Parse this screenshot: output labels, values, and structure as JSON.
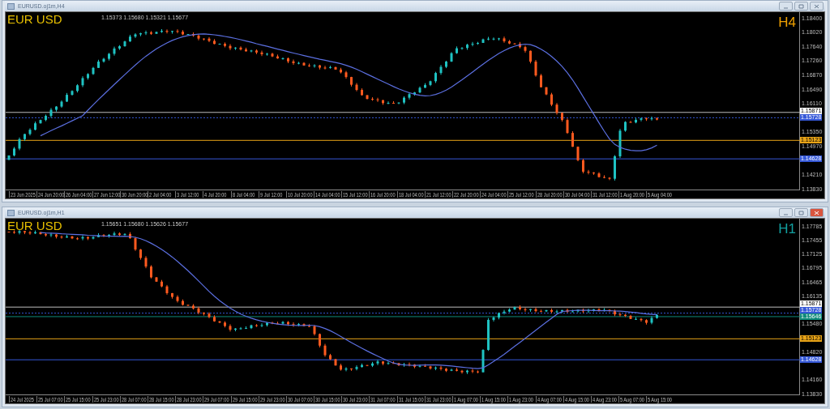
{
  "windows": [
    {
      "title": "EURUSD.oj1m,H4",
      "symbol": "EUR USD",
      "info": "1.15373 1.15680 1.15321 1.15677",
      "timeframe": "H4",
      "color": "#f0a000",
      "active": false,
      "price_axis": [
        "1.18400",
        "1.18020",
        "1.17640",
        "1.17260",
        "1.16870",
        "1.16490",
        "1.16110",
        "1.15350",
        "1.14970",
        "1.14210",
        "1.13830"
      ],
      "price_lines": [
        {
          "label": "1.15871",
          "color": "#ffffff",
          "kind": "solid"
        },
        {
          "label": "1.15728",
          "color": "#3558d8",
          "kind": "dotted"
        },
        {
          "label": "1.15123",
          "color": "#e8a317",
          "kind": "solid"
        },
        {
          "label": "1.14628",
          "color": "#3558d8",
          "kind": "solid"
        }
      ],
      "time_axis": [
        "23 Jun 2025",
        "24 Jun 20:00",
        "26 Jun 04:00",
        "27 Jun 12:00",
        "30 Jun 20:00",
        "2 Jul 04:00",
        "3 Jul 12:00",
        "4 Jul 20:00",
        "8 Jul 04:00",
        "9 Jul 12:00",
        "10 Jul 20:00",
        "14 Jul 04:00",
        "15 Jul 12:00",
        "16 Jul 20:00",
        "18 Jul 04:00",
        "21 Jul 12:00",
        "22 Jul 20:00",
        "24 Jul 04:00",
        "25 Jul 12:00",
        "28 Jul 20:00",
        "30 Jul 04:00",
        "31 Jul 12:00",
        "1 Aug 20:00",
        "5 Aug 04:00"
      ]
    },
    {
      "title": "EURUSD.oj1m,H1",
      "symbol": "EUR USD",
      "info": "1.15651 1.15680 1.15626 1.15677",
      "timeframe": "H1",
      "color": "#12a0a0",
      "active": true,
      "price_axis": [
        "1.17785",
        "1.17455",
        "1.17125",
        "1.16795",
        "1.16465",
        "1.16135",
        "1.15480",
        "1.14820",
        "1.14160",
        "1.13830"
      ],
      "price_lines": [
        {
          "label": "1.15871",
          "color": "#ffffff",
          "kind": "solid"
        },
        {
          "label": "1.15728",
          "color": "#3558d8",
          "kind": "dotted"
        },
        {
          "label": "1.15646",
          "color": "#0e8a7a",
          "kind": "solid"
        },
        {
          "label": "1.15123",
          "color": "#e8a317",
          "kind": "solid"
        },
        {
          "label": "1.14628",
          "color": "#3558d8",
          "kind": "solid"
        }
      ],
      "time_axis": [
        "24 Jul 2025",
        "25 Jul 07:00",
        "25 Jul 15:00",
        "25 Jul 23:00",
        "28 Jul 07:00",
        "28 Jul 15:00",
        "28 Jul 23:00",
        "29 Jul 07:00",
        "29 Jul 15:00",
        "29 Jul 23:00",
        "30 Jul 07:00",
        "30 Jul 15:00",
        "30 Jul 23:00",
        "31 Jul 07:00",
        "31 Jul 15:00",
        "31 Jul 23:00",
        "1 Aug 07:00",
        "1 Aug 15:00",
        "1 Aug 23:00",
        "4 Aug 07:00",
        "4 Aug 15:00",
        "4 Aug 23:00",
        "5 Aug 07:00",
        "5 Aug 15:00"
      ]
    }
  ]
}
